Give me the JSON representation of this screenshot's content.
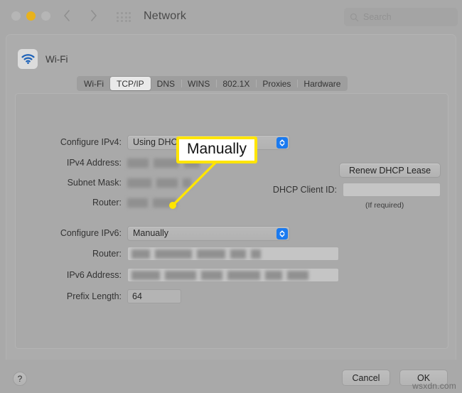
{
  "window": {
    "title": "Network",
    "traffic_lights": [
      "close",
      "minimize",
      "zoom"
    ],
    "back_label": "back",
    "forward_label": "forward",
    "grid_label": "show-all"
  },
  "search": {
    "placeholder": "Search"
  },
  "service": {
    "name": "Wi-Fi"
  },
  "tabs": [
    {
      "label": "Wi-Fi",
      "active": false
    },
    {
      "label": "TCP/IP",
      "active": true
    },
    {
      "label": "DNS",
      "active": false
    },
    {
      "label": "WINS",
      "active": false
    },
    {
      "label": "802.1X",
      "active": false
    },
    {
      "label": "Proxies",
      "active": false
    },
    {
      "label": "Hardware",
      "active": false
    }
  ],
  "ipv4": {
    "configure_label": "Configure IPv4:",
    "configure_value": "Using DHCP",
    "address_label": "IPv4 Address:",
    "address_value": "",
    "subnet_label": "Subnet Mask:",
    "subnet_value": "",
    "router_label": "Router:",
    "router_value": "",
    "renew_button": "Renew DHCP Lease",
    "client_id_label": "DHCP Client ID:",
    "client_id_value": "",
    "client_id_hint": "(If required)"
  },
  "ipv6": {
    "configure_label": "Configure IPv6:",
    "configure_value": "Manually",
    "router_label": "Router:",
    "router_value": "",
    "address_label": "IPv6 Address:",
    "address_value": "",
    "prefix_label": "Prefix Length:",
    "prefix_value": "64"
  },
  "callout": {
    "text": "Manually",
    "border_color": "#ffe500"
  },
  "footer": {
    "help_label": "?",
    "cancel_label": "Cancel",
    "ok_label": "OK",
    "watermark": "wsxdn.com"
  }
}
